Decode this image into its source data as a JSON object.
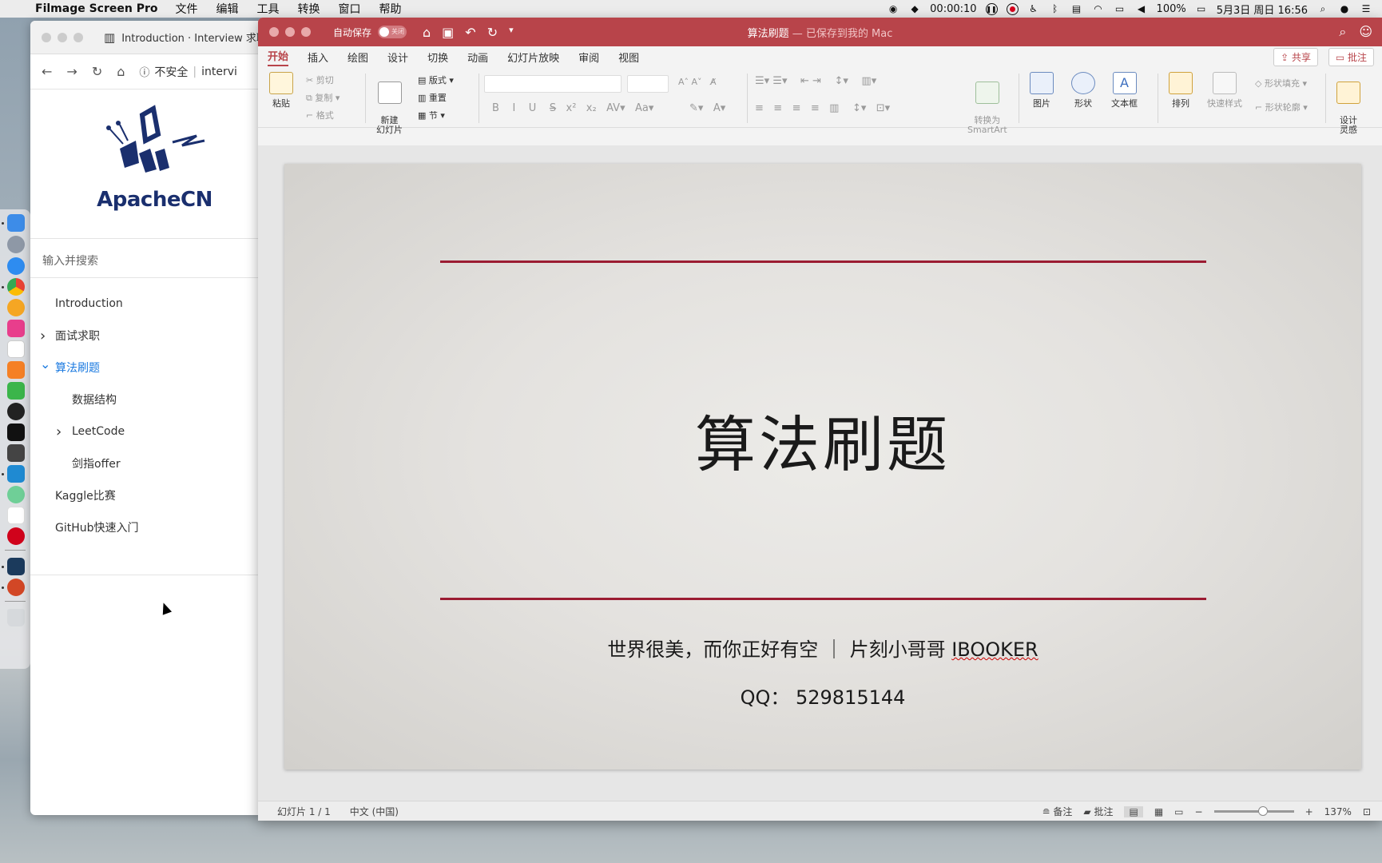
{
  "menubar": {
    "app_name": "Filmage Screen Pro",
    "items": [
      "文件",
      "编辑",
      "工具",
      "转换",
      "窗口",
      "帮助"
    ],
    "timer": "00:00:10",
    "battery": "100%",
    "datetime": "5月3日 周日 16:56"
  },
  "browser": {
    "tab_title": "Introduction · Interview 求职",
    "url_security": "不安全",
    "url_text": "intervi",
    "logo_text": "ApacheCN",
    "search_placeholder": "输入并搜索",
    "nav": [
      {
        "label": "Introduction",
        "level": 0,
        "chevron": "",
        "active": false
      },
      {
        "label": "面试求职",
        "level": 0,
        "chevron": "›",
        "active": false
      },
      {
        "label": "算法刷题",
        "level": 0,
        "chevron": "⌄",
        "active": true
      },
      {
        "label": "数据结构",
        "level": 1,
        "chevron": "",
        "active": false
      },
      {
        "label": "LeetCode",
        "level": 1,
        "chevron": "›",
        "active": false
      },
      {
        "label": "剑指offer",
        "level": 1,
        "chevron": "",
        "active": false
      },
      {
        "label": "Kaggle比赛",
        "level": 0,
        "chevron": "",
        "active": false
      },
      {
        "label": "GitHub快速入门",
        "level": 0,
        "chevron": "",
        "active": false
      }
    ]
  },
  "ppt": {
    "autosave_label": "自动保存",
    "autosave_state": "关闭",
    "doc_title": "算法刷题",
    "doc_subtitle": "— 已保存到我的 Mac",
    "tabs": [
      "开始",
      "插入",
      "绘图",
      "设计",
      "切换",
      "动画",
      "幻灯片放映",
      "审阅",
      "视图"
    ],
    "share_label": "共享",
    "comment_label": "批注",
    "ribbon": {
      "paste": "粘贴",
      "cut": "剪切",
      "copy": "复制",
      "format": "格式",
      "new_slide": "新建\n幻灯片",
      "layout": "版式",
      "reset": "重置",
      "section": "节",
      "smartart": "转换为\nSmartArt",
      "picture": "图片",
      "shape": "形状",
      "textbox": "文本框",
      "arrange": "排列",
      "quick_style": "快速样式",
      "shape_fill": "形状填充",
      "shape_outline": "形状轮廓",
      "designer": "设计\n灵感"
    },
    "slide": {
      "title": "算法刷题",
      "line_a": "世界很美，而你正好有空 ｜ 片刻小哥哥 ",
      "line_b": "IBOOKER",
      "qq": "QQ： 529815144"
    },
    "status": {
      "slide_count": "幻灯片 1 / 1",
      "language": "中文 (中国)",
      "notes": "备注",
      "comments": "批注",
      "zoom": "137%"
    }
  }
}
